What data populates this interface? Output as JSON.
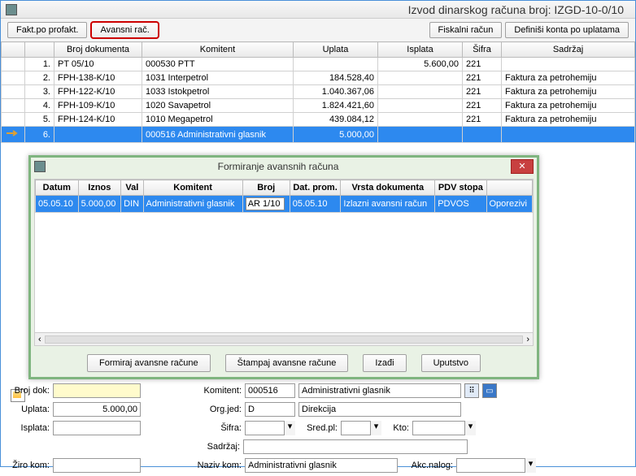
{
  "window": {
    "title": "Izvod dinarskog računa broj: IZGD-10-0/10"
  },
  "toolbar": {
    "fakt": "Fakt.po profakt.",
    "avans": "Avansni rač.",
    "fiskal": "Fiskalni račun",
    "def_konta": "Definiši konta po uplatama"
  },
  "table": {
    "headers": {
      "idx": "",
      "doc": "Broj dokumenta",
      "komitent": "Komitent",
      "uplata": "Uplata",
      "isplata": "Isplata",
      "sifra": "Šifra",
      "sadrzaj": "Sadržaj"
    },
    "rows": [
      {
        "idx": "1.",
        "doc": "PT 05/10",
        "kom": "000530 PTT",
        "up": "",
        "isp": "5.600,00",
        "sif": "221",
        "sad": ""
      },
      {
        "idx": "2.",
        "doc": "FPH-138-K/10",
        "kom": "1031 Interpetrol",
        "up": "184.528,40",
        "isp": "",
        "sif": "221",
        "sad": "Faktura za petrohemiju"
      },
      {
        "idx": "3.",
        "doc": "FPH-122-K/10",
        "kom": "1033 Istokpetrol",
        "up": "1.040.367,06",
        "isp": "",
        "sif": "221",
        "sad": "Faktura za petrohemiju"
      },
      {
        "idx": "4.",
        "doc": "FPH-109-K/10",
        "kom": "1020 Savapetrol",
        "up": "1.824.421,60",
        "isp": "",
        "sif": "221",
        "sad": "Faktura za petrohemiju"
      },
      {
        "idx": "5.",
        "doc": "FPH-124-K/10",
        "kom": "1010 Megapetrol",
        "up": "439.084,12",
        "isp": "",
        "sif": "221",
        "sad": "Faktura za petrohemiju"
      },
      {
        "idx": "6.",
        "doc": "",
        "kom": "000516 Administrativni glasnik",
        "up": "5.000,00",
        "isp": "",
        "sif": "",
        "sad": ""
      }
    ]
  },
  "dialog": {
    "title": "Formiranje avansnih računa",
    "headers": {
      "datum": "Datum",
      "iznos": "Iznos",
      "val": "Val",
      "komitent": "Komitent",
      "broj": "Broj",
      "datprom": "Dat. prom.",
      "vrsta": "Vrsta dokumenta",
      "pdv": "PDV stopa",
      "ost": ""
    },
    "row": {
      "datum": "05.05.10",
      "iznos": "5.000,00",
      "val": "DIN",
      "komitent": "Administrativni glasnik",
      "broj": "AR 1/10",
      "datprom": "05.05.10",
      "vrsta": "Izlazni avansni račun",
      "pdv": "PDVOS",
      "ost": "Oporezivi"
    },
    "buttons": {
      "form": "Formiraj avansne račune",
      "print": "Štampaj avansne račune",
      "exit": "Izađi",
      "help": "Uputstvo"
    }
  },
  "form": {
    "labels": {
      "brojdok": "Broj dok:",
      "uplata": "Uplata:",
      "isplata": "Isplata:",
      "komitent": "Komitent:",
      "orgjed": "Org.jed:",
      "sifra": "Šifra:",
      "sredpl": "Sred.pl:",
      "kto": "Kto:",
      "sadrzaj": "Sadržaj:",
      "zirokom": "Žiro kom:",
      "nazivkom": "Naziv kom:",
      "akcnalog": "Akc.nalog:"
    },
    "values": {
      "brojdok": "",
      "uplata": "5.000,00",
      "isplata": "",
      "komitent_code": "000516",
      "komitent_name": "Administrativni glasnik",
      "orgjed_code": "D",
      "orgjed_name": "Direkcija",
      "sifra": "",
      "sredpl": "",
      "kto": "",
      "sadrzaj": "",
      "zirokom": "",
      "nazivkom": "Administrativni glasnik",
      "akcnalog": ""
    }
  }
}
